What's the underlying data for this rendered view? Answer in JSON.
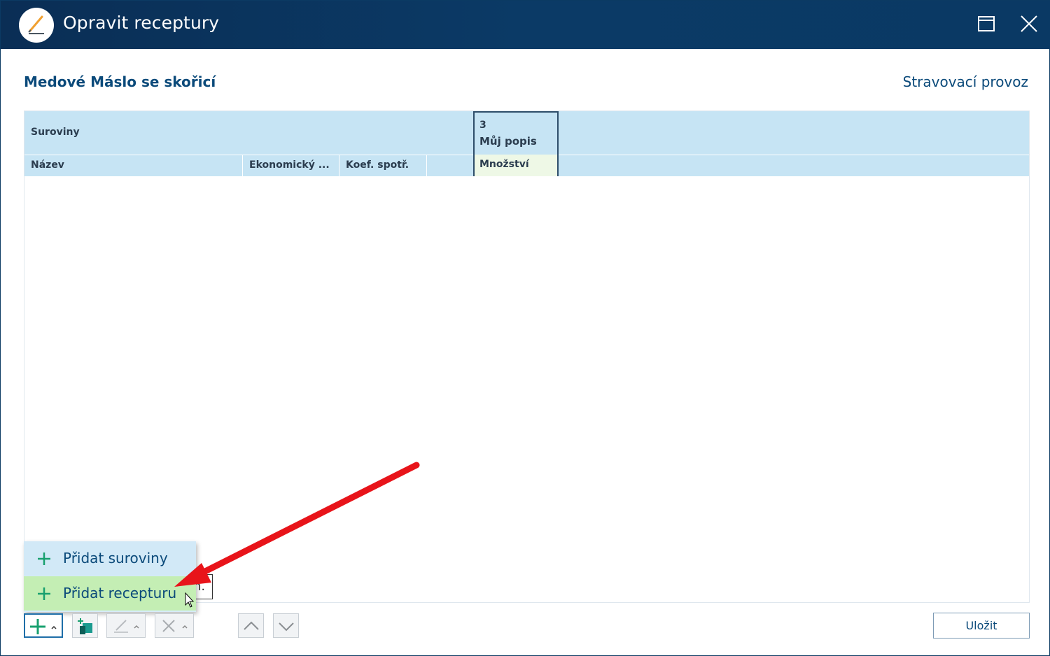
{
  "window": {
    "title": "Opravit receptury",
    "maximize_icon": "maximize-icon",
    "close_icon": "close-icon"
  },
  "header": {
    "recipe_name": "Medové Máslo se skořicí",
    "context": "Stravovací provoz"
  },
  "grid": {
    "group_label": "Suroviny",
    "columns": [
      "Název",
      "Ekonomický ...",
      "Koef. spotř."
    ],
    "selected_column": {
      "number": "3",
      "description": "Můj popis",
      "sub_label": "Množství"
    },
    "rows": []
  },
  "add_menu": {
    "items": [
      {
        "label": "Přidat suroviny",
        "icon": "plus-icon"
      },
      {
        "label": "Přidat recepturu",
        "icon": "plus-icon"
      }
    ]
  },
  "tooltip_fragment": "n.",
  "toolbar": {
    "save_label": "Uložit"
  },
  "colors": {
    "titlebar": "#0b3a66",
    "accent": "#0b4a7a",
    "header_bg": "#c6e4f4",
    "menu_hover": "#c4eeb4",
    "annotation_arrow": "#e8141a"
  }
}
